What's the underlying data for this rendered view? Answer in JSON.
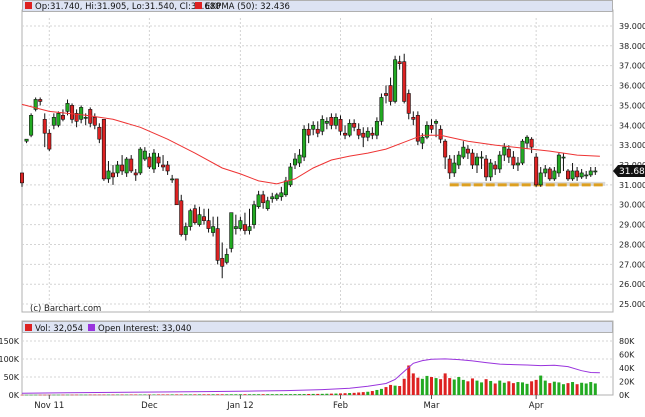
{
  "price_legend": {
    "ohlc_label": "Op:31.740, Hi:31.905, Lo:31.540, Cl:31.680",
    "ema_label": "EXPMA (50): 32.436",
    "last_price_label": "31.680"
  },
  "copyright": "(c) Barchart.com",
  "volume_legend": {
    "volume_label": "Vol: 32,054",
    "oi_label": "Open Interest: 33,040"
  },
  "colors": {
    "up": "#22aa22",
    "down": "#dd2222",
    "ema": "#ee3333",
    "open_interest": "#9933dd",
    "legend_band": "#dde3f3",
    "support_zone": "#dda020"
  },
  "chart_data": [
    {
      "type": "candlestick",
      "title": "",
      "x_tick_labels": [
        "Nov 11",
        "Dec",
        "Jan 12",
        "Feb",
        "Mar",
        "Apr"
      ],
      "y_tick_labels": [
        "25.000",
        "26.000",
        "27.000",
        "28.000",
        "29.000",
        "30.000",
        "31.000",
        "32.000",
        "33.000",
        "34.000",
        "35.000",
        "36.000",
        "37.000",
        "38.000",
        "39.000"
      ],
      "ylim": [
        24.6,
        39.4
      ],
      "grid": true,
      "last_price": 31.68,
      "support_zone": [
        30.95,
        31.15
      ],
      "ohlc": [
        [
          31.6,
          31.1,
          31.6,
          30.9
        ],
        [
          33.2,
          33.3,
          33.3,
          33.1
        ],
        [
          33.5,
          34.5,
          34.6,
          33.4
        ],
        [
          34.8,
          35.3,
          35.4,
          34.7
        ],
        [
          35.3,
          35.2,
          35.4,
          35.0
        ],
        [
          34.3,
          33.6,
          34.6,
          32.9
        ],
        [
          33.6,
          32.8,
          33.8,
          32.7
        ],
        [
          34.0,
          34.4,
          34.6,
          33.8
        ],
        [
          34.0,
          34.6,
          34.7,
          33.9
        ],
        [
          34.5,
          34.3,
          34.8,
          34.2
        ],
        [
          34.7,
          35.1,
          35.3,
          34.5
        ],
        [
          35.0,
          34.3,
          35.1,
          34.1
        ],
        [
          34.6,
          34.2,
          34.8,
          33.9
        ],
        [
          34.3,
          34.9,
          35.0,
          34.1
        ],
        [
          34.4,
          34.4,
          34.6,
          34.0
        ],
        [
          34.8,
          34.1,
          34.9,
          33.9
        ],
        [
          34.4,
          34.0,
          34.6,
          33.8
        ],
        [
          33.9,
          33.3,
          34.1,
          33.1
        ],
        [
          34.3,
          31.3,
          34.3,
          31.2
        ],
        [
          31.3,
          31.7,
          32.2,
          31.1
        ],
        [
          31.6,
          31.4,
          32.0,
          31.0
        ],
        [
          31.6,
          32.0,
          32.2,
          31.4
        ],
        [
          32.0,
          31.7,
          32.5,
          31.5
        ],
        [
          31.6,
          32.3,
          32.4,
          31.4
        ],
        [
          32.3,
          31.7,
          32.5,
          31.6
        ],
        [
          31.6,
          31.5,
          31.8,
          31.2
        ],
        [
          31.6,
          32.8,
          32.9,
          31.5
        ],
        [
          32.3,
          32.7,
          32.9,
          32.2
        ],
        [
          32.4,
          31.9,
          32.6,
          31.8
        ],
        [
          31.8,
          32.6,
          32.8,
          31.6
        ],
        [
          32.4,
          32.1,
          32.6,
          31.9
        ],
        [
          32.0,
          31.9,
          32.5,
          31.7
        ],
        [
          32.0,
          31.7,
          32.2,
          31.5
        ],
        [
          31.3,
          31.3,
          31.5,
          31.1
        ],
        [
          31.3,
          30.0,
          31.3,
          30.0
        ],
        [
          30.2,
          28.5,
          30.5,
          28.4
        ],
        [
          28.5,
          28.9,
          29.1,
          28.2
        ],
        [
          28.9,
          29.7,
          29.8,
          28.7
        ],
        [
          29.8,
          29.1,
          30.0,
          29.0
        ],
        [
          29.0,
          29.5,
          29.9,
          28.9
        ],
        [
          29.4,
          29.2,
          29.8,
          29.0
        ],
        [
          29.2,
          28.8,
          29.8,
          28.6
        ],
        [
          28.6,
          28.9,
          29.4,
          28.4
        ],
        [
          28.8,
          27.2,
          29.4,
          27.0
        ],
        [
          27.3,
          26.9,
          28.1,
          26.3
        ],
        [
          27.1,
          27.5,
          27.8,
          27.0
        ],
        [
          27.8,
          29.6,
          29.6,
          27.6
        ],
        [
          28.8,
          28.9,
          29.5,
          28.5
        ],
        [
          28.8,
          29.2,
          29.4,
          28.7
        ],
        [
          29.0,
          28.7,
          29.6,
          28.5
        ],
        [
          28.7,
          28.9,
          29.8,
          28.5
        ],
        [
          29.0,
          30.0,
          30.2,
          28.8
        ],
        [
          29.9,
          30.5,
          30.7,
          29.8
        ],
        [
          30.5,
          30.1,
          30.7,
          29.8
        ],
        [
          29.8,
          30.2,
          30.4,
          29.7
        ],
        [
          30.3,
          30.4,
          30.6,
          30.1
        ],
        [
          30.3,
          30.5,
          30.6,
          30.2
        ],
        [
          30.4,
          30.6,
          30.9,
          30.2
        ],
        [
          30.5,
          31.2,
          31.4,
          30.4
        ],
        [
          31.0,
          31.9,
          32.1,
          30.9
        ],
        [
          32.0,
          32.3,
          32.6,
          31.8
        ],
        [
          32.1,
          32.5,
          32.8,
          31.9
        ],
        [
          32.4,
          33.8,
          34.0,
          32.2
        ],
        [
          33.8,
          33.5,
          34.1,
          33.1
        ],
        [
          33.8,
          34.0,
          34.2,
          33.5
        ],
        [
          33.8,
          33.6,
          34.2,
          33.4
        ],
        [
          33.7,
          34.3,
          34.5,
          33.5
        ],
        [
          34.1,
          34.2,
          34.4,
          33.8
        ],
        [
          34.4,
          34.0,
          34.6,
          33.8
        ],
        [
          34.0,
          34.4,
          34.6,
          33.8
        ],
        [
          34.3,
          33.7,
          34.5,
          33.5
        ],
        [
          33.6,
          33.5,
          34.0,
          33.3
        ],
        [
          33.5,
          34.1,
          34.3,
          33.4
        ],
        [
          34.1,
          33.9,
          34.3,
          33.7
        ],
        [
          33.8,
          33.5,
          34.1,
          33.3
        ],
        [
          33.6,
          33.4,
          33.9,
          32.9
        ],
        [
          33.4,
          33.7,
          33.9,
          33.2
        ],
        [
          33.6,
          33.5,
          33.9,
          33.3
        ],
        [
          33.5,
          34.2,
          34.4,
          33.3
        ],
        [
          34.2,
          35.4,
          35.6,
          34.0
        ],
        [
          35.6,
          35.5,
          36.0,
          35.1
        ],
        [
          36.0,
          35.2,
          36.4,
          35.0
        ],
        [
          35.2,
          37.3,
          37.5,
          35.1
        ],
        [
          37.2,
          37.1,
          37.5,
          36.8
        ],
        [
          37.2,
          35.2,
          37.6,
          35.1
        ],
        [
          35.6,
          34.6,
          35.8,
          34.3
        ],
        [
          34.4,
          34.3,
          34.7,
          34.0
        ],
        [
          34.5,
          33.2,
          34.7,
          33.0
        ],
        [
          33.1,
          33.4,
          33.6,
          32.8
        ],
        [
          33.4,
          34.0,
          34.2,
          33.3
        ],
        [
          34.0,
          33.8,
          34.3,
          33.6
        ],
        [
          34.1,
          34.2,
          34.3,
          33.4
        ],
        [
          33.8,
          33.3,
          34.0,
          33.1
        ],
        [
          33.2,
          32.4,
          33.3,
          31.8
        ],
        [
          32.3,
          31.6,
          32.5,
          31.3
        ],
        [
          31.6,
          32.1,
          32.5,
          31.4
        ],
        [
          32.0,
          32.5,
          32.7,
          31.8
        ],
        [
          32.4,
          32.9,
          33.2,
          32.3
        ],
        [
          32.8,
          32.6,
          33.0,
          32.3
        ],
        [
          32.6,
          32.0,
          32.8,
          31.8
        ],
        [
          32.0,
          32.4,
          32.6,
          31.6
        ],
        [
          32.4,
          32.4,
          32.7,
          31.8
        ],
        [
          32.3,
          31.4,
          32.5,
          31.2
        ],
        [
          31.4,
          32.1,
          32.3,
          31.2
        ],
        [
          32.0,
          31.8,
          32.2,
          31.5
        ],
        [
          31.8,
          32.5,
          32.7,
          31.6
        ],
        [
          32.5,
          32.9,
          33.1,
          32.2
        ],
        [
          32.8,
          32.4,
          33.0,
          32.1
        ],
        [
          32.4,
          32.0,
          32.7,
          31.8
        ],
        [
          32.0,
          32.1,
          32.4,
          31.7
        ],
        [
          32.1,
          33.2,
          33.3,
          32.0
        ],
        [
          33.1,
          33.4,
          33.5,
          32.8
        ],
        [
          33.3,
          32.9,
          33.4,
          32.6
        ],
        [
          32.4,
          31.0,
          32.6,
          30.9
        ],
        [
          31.0,
          31.6,
          31.9,
          30.9
        ],
        [
          31.6,
          31.8,
          32.0,
          31.4
        ],
        [
          31.8,
          31.3,
          31.9,
          31.2
        ],
        [
          31.3,
          31.7,
          31.9,
          31.2
        ],
        [
          31.6,
          32.5,
          32.6,
          31.4
        ],
        [
          32.4,
          32.4,
          32.6,
          31.7
        ],
        [
          31.7,
          31.3,
          31.8,
          31.2
        ],
        [
          31.3,
          31.7,
          32.1,
          31.2
        ],
        [
          31.7,
          31.4,
          31.9,
          31.2
        ],
        [
          31.4,
          31.6,
          31.8,
          31.3
        ],
        [
          31.5,
          31.5,
          31.7,
          31.3
        ],
        [
          31.5,
          31.7,
          31.9,
          31.4
        ],
        [
          31.7,
          31.7,
          31.9,
          31.5
        ]
      ],
      "ema": [
        [
          0,
          35.05
        ],
        [
          6,
          34.7
        ],
        [
          14,
          34.5
        ],
        [
          20,
          34.3
        ],
        [
          26,
          33.9
        ],
        [
          32,
          33.3
        ],
        [
          38,
          32.6
        ],
        [
          44,
          31.85
        ],
        [
          48,
          31.55
        ],
        [
          52,
          31.2
        ],
        [
          56,
          31.05
        ],
        [
          60,
          31.3
        ],
        [
          64,
          31.85
        ],
        [
          68,
          32.25
        ],
        [
          72,
          32.45
        ],
        [
          76,
          32.6
        ],
        [
          80,
          32.8
        ],
        [
          84,
          33.15
        ],
        [
          88,
          33.5
        ],
        [
          92,
          33.5
        ],
        [
          98,
          33.2
        ],
        [
          104,
          33.0
        ],
        [
          110,
          32.85
        ],
        [
          116,
          32.7
        ],
        [
          122,
          32.5
        ],
        [
          127,
          32.44
        ]
      ]
    },
    {
      "type": "bar+line",
      "title": "",
      "y_left_tick_labels": [
        "0K",
        "50K",
        "100K",
        "150K"
      ],
      "y_right_tick_labels": [
        "0K",
        "20K",
        "40K",
        "60K",
        "80K"
      ],
      "volume_ylim": [
        0,
        150000
      ],
      "oi_ylim": [
        0,
        80000
      ],
      "volume": [
        500,
        500,
        500,
        600,
        600,
        600,
        700,
        700,
        700,
        800,
        800,
        800,
        900,
        900,
        900,
        1000,
        1000,
        1000,
        1100,
        1100,
        1100,
        1200,
        1200,
        1200,
        1300,
        1300,
        1300,
        1400,
        1400,
        1400,
        1500,
        1500,
        1500,
        1600,
        1600,
        1600,
        1700,
        1700,
        1700,
        1800,
        1800,
        1800,
        1900,
        1900,
        1900,
        2000,
        2000,
        2000,
        2100,
        2100,
        2100,
        2200,
        2200,
        2200,
        2300,
        2300,
        2300,
        2400,
        2400,
        2400,
        2500,
        2500,
        2600,
        2800,
        3000,
        3000,
        3200,
        3500,
        3800,
        4000,
        4500,
        5000,
        5500,
        6000,
        7000,
        8000,
        9000,
        11000,
        14000,
        17000,
        22000,
        28000,
        26000,
        25000,
        45000,
        82000,
        60000,
        48000,
        45000,
        53000,
        50000,
        47000,
        44000,
        60000,
        47000,
        43000,
        50000,
        42000,
        38000,
        46000,
        40000,
        35000,
        44000,
        39000,
        32000,
        40000,
        34000,
        38000,
        33000,
        36000,
        35000,
        31000,
        38000,
        42000,
        54000,
        40000,
        33000,
        37000,
        35000,
        30000,
        33000,
        36000,
        30000,
        34000,
        32000,
        36000,
        32054
      ],
      "open_interest": [
        [
          0,
          2500
        ],
        [
          10,
          3200
        ],
        [
          20,
          3800
        ],
        [
          30,
          4400
        ],
        [
          40,
          5000
        ],
        [
          50,
          5800
        ],
        [
          58,
          6500
        ],
        [
          66,
          8000
        ],
        [
          72,
          10000
        ],
        [
          76,
          13000
        ],
        [
          80,
          17000
        ],
        [
          82,
          23000
        ],
        [
          84,
          35000
        ],
        [
          86,
          47000
        ],
        [
          88,
          51000
        ],
        [
          90,
          53000
        ],
        [
          93,
          53500
        ],
        [
          96,
          52500
        ],
        [
          99,
          50500
        ],
        [
          102,
          48000
        ],
        [
          105,
          45800
        ],
        [
          108,
          45000
        ],
        [
          111,
          44500
        ],
        [
          114,
          43500
        ],
        [
          117,
          44000
        ],
        [
          120,
          42000
        ],
        [
          123,
          36000
        ],
        [
          125,
          33300
        ],
        [
          127,
          33040
        ]
      ]
    }
  ]
}
